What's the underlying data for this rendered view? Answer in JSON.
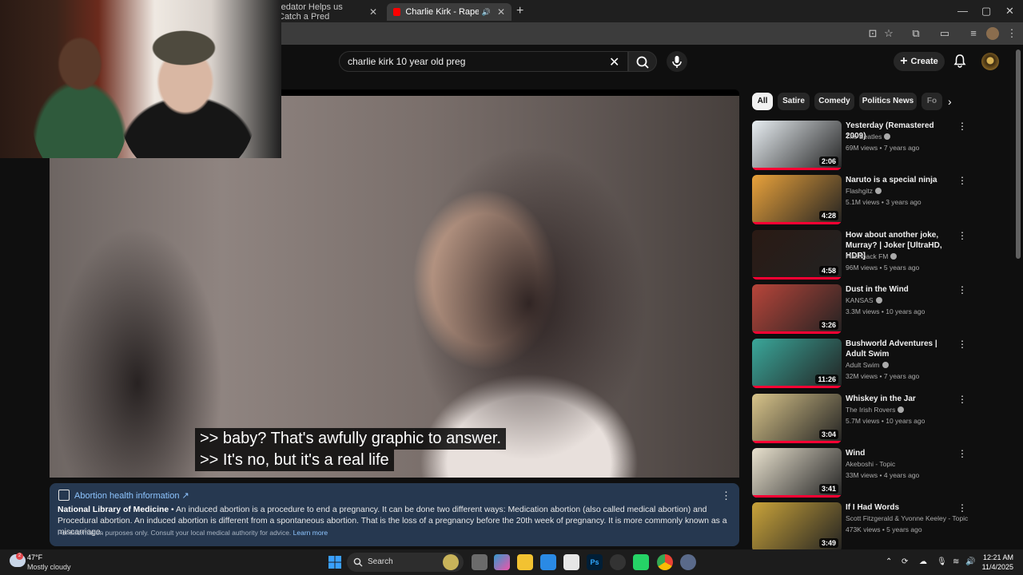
{
  "browser": {
    "tabs": [
      {
        "title": "redator Helps us Catch a Pred",
        "active": false
      },
      {
        "title": "Charlie Kirk - Rape and Ab",
        "active": true
      }
    ],
    "window_controls": [
      "—",
      "▢",
      "✕"
    ]
  },
  "youtube": {
    "search": {
      "value": "charlie kirk 10 year old preg"
    },
    "create_label": "Create",
    "caption": {
      "line1": ">> baby? That's awfully graphic to answer.",
      "line2": ">> It's no, but it's a real life"
    },
    "info_panel": {
      "title": "Abortion health information",
      "source": "National Library of Medicine",
      "body": " • An induced abortion is a procedure to end a pregnancy. It can be done two different ways: Medication abortion (also called medical abortion) and Procedural abortion. An induced abortion is different from a spontaneous abortion. That is the loss of a pregnancy before the 20th week of pregnancy. It is more commonly known as a miscarriage.",
      "footer": "For information purposes only. Consult your local medical authority for advice.",
      "learn_more": "Learn more"
    },
    "chips": [
      "All",
      "Satire",
      "Comedy",
      "Politics News",
      "Fo"
    ],
    "recommendations": [
      {
        "title": "Yesterday (Remastered 2009)",
        "channel": "The Beatles",
        "meta": "69M views • 7 years ago",
        "duration": "2:06",
        "verified": true,
        "color": "#e8eef2"
      },
      {
        "title": "Naruto is a special ninja",
        "channel": "Flashgitz",
        "meta": "5.1M views • 3 years ago",
        "duration": "4:28",
        "verified": true,
        "color": "#e9a23b"
      },
      {
        "title": "How about another joke, Murray? | Joker [UltraHD, HDR]",
        "channel": "Flashback FM",
        "meta": "96M views • 5 years ago",
        "duration": "4:58",
        "verified": true,
        "color": "#2a1a14"
      },
      {
        "title": "Dust in the Wind",
        "channel": "KANSAS",
        "meta": "3.3M views • 10 years ago",
        "duration": "3:26",
        "verified": true,
        "color": "#b8453a"
      },
      {
        "title": "Bushworld Adventures | Adult Swim",
        "channel": "Adult Swim",
        "meta": "32M views • 7 years ago",
        "duration": "11:26",
        "verified": true,
        "color": "#3aa79a"
      },
      {
        "title": "Whiskey in the Jar",
        "channel": "The Irish Rovers",
        "meta": "5.7M views • 10 years ago",
        "duration": "3:04",
        "verified": true,
        "color": "#d8c48a"
      },
      {
        "title": "Wind",
        "channel": "Akeboshi - Topic",
        "meta": "33M views • 4 years ago",
        "duration": "3:41",
        "verified": false,
        "color": "#e9e2cf"
      },
      {
        "title": "If I Had Words",
        "channel": "Scott Fitzgerald & Yvonne Keeley - Topic",
        "meta": "473K views • 5 years ago",
        "duration": "3:49",
        "verified": false,
        "color": "#c9a33a"
      }
    ]
  },
  "taskbar": {
    "weather_temp": "47°F",
    "weather_desc": "Mostly cloudy",
    "weather_badge": "2",
    "search_label": "Search",
    "time": "12:21 AM",
    "date": "11/4/2025"
  }
}
